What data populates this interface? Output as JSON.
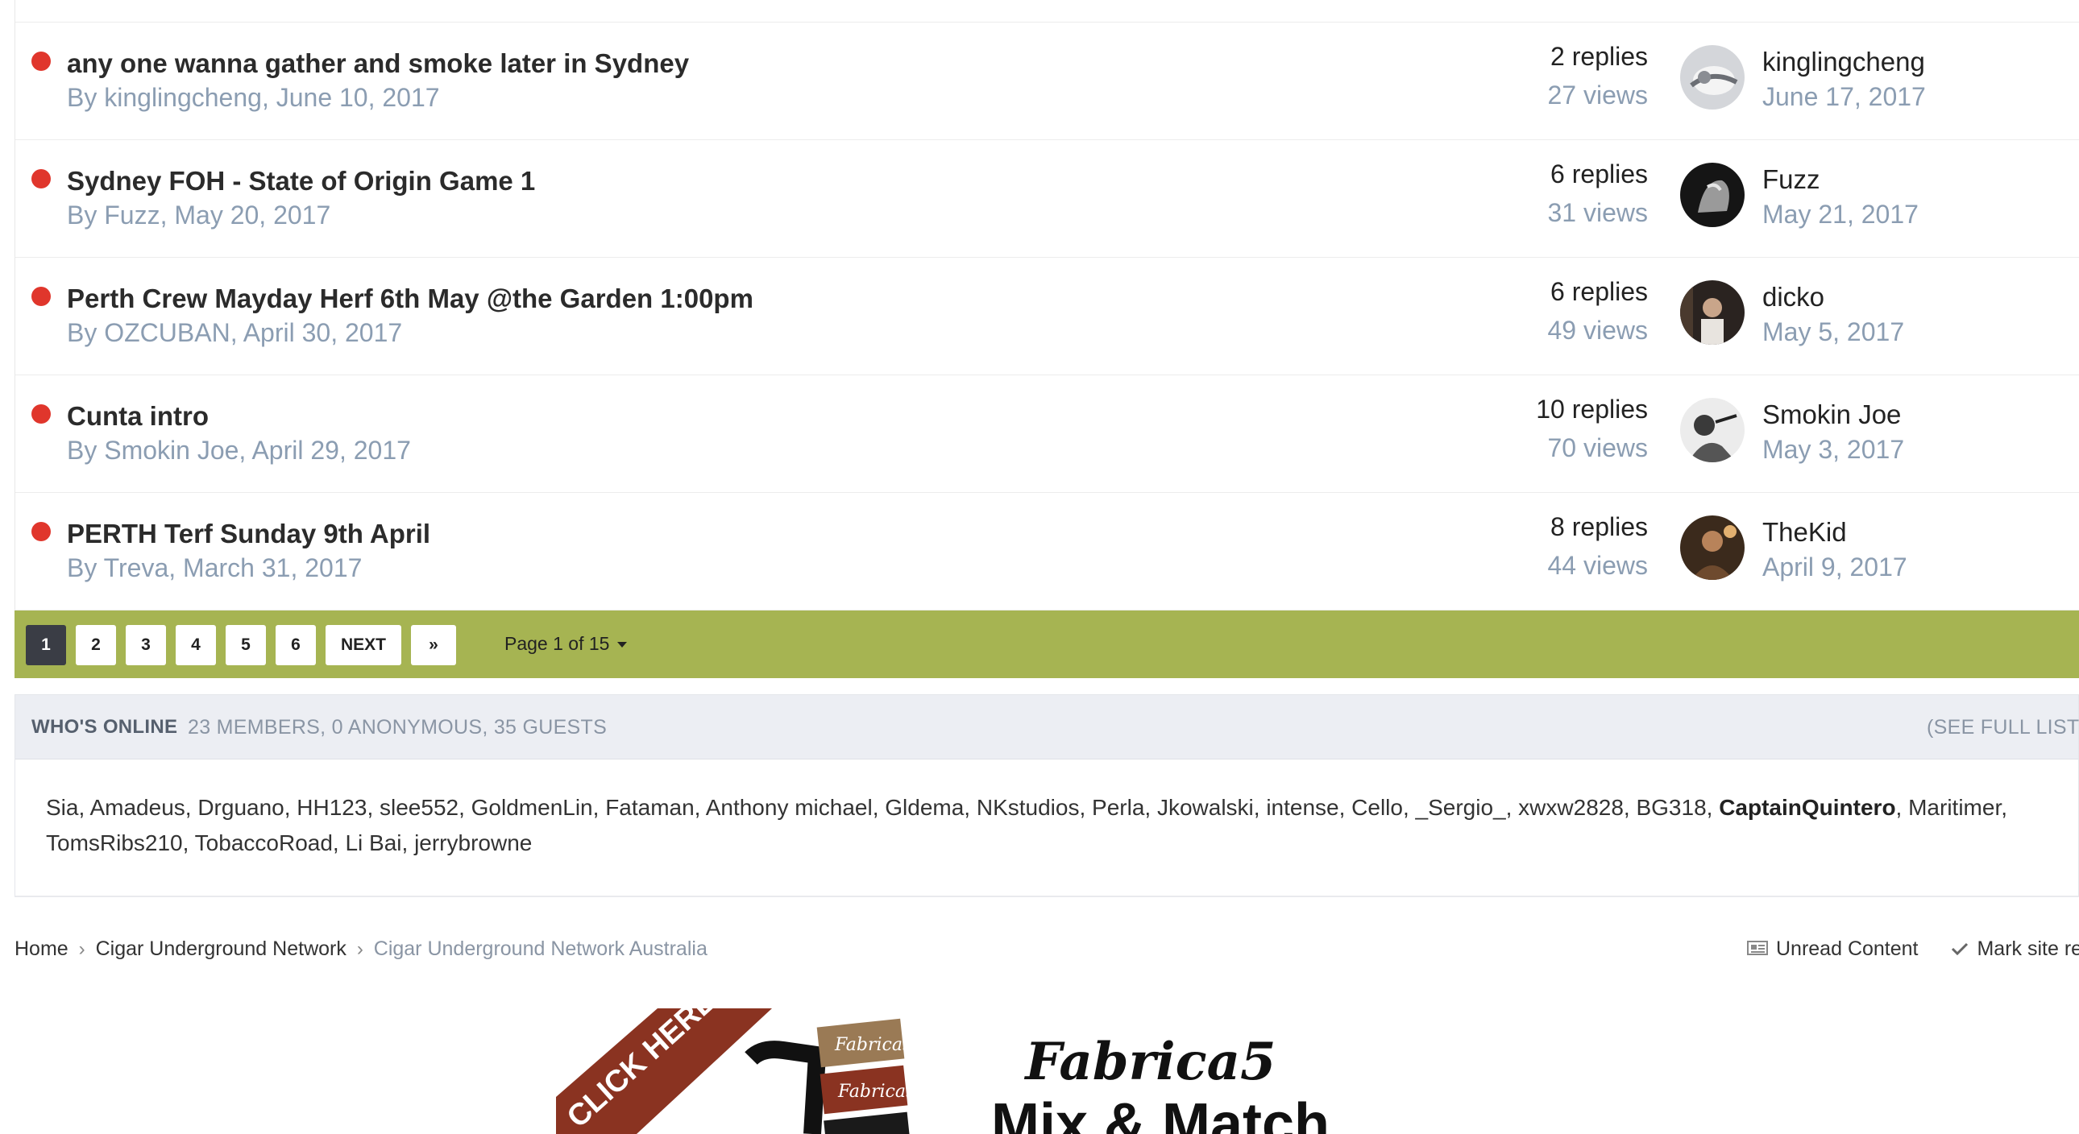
{
  "topics": [
    {
      "title": "any one wanna gather and smoke later in Sydney",
      "meta": "By kinglingcheng, June 10, 2017",
      "replies": "2 replies",
      "views": "27 views",
      "last_poster": "kinglingcheng",
      "last_date": "June 17, 2017"
    },
    {
      "title": "Sydney FOH - State of Origin Game 1",
      "meta": "By Fuzz, May 20, 2017",
      "replies": "6 replies",
      "views": "31 views",
      "last_poster": "Fuzz",
      "last_date": "May 21, 2017"
    },
    {
      "title": "Perth Crew Mayday Herf 6th May @the Garden 1:00pm",
      "meta": "By OZCUBAN, April 30, 2017",
      "replies": "6 replies",
      "views": "49 views",
      "last_poster": "dicko",
      "last_date": "May 5, 2017"
    },
    {
      "title": "Cunta intro",
      "meta": "By Smokin Joe, April 29, 2017",
      "replies": "10 replies",
      "views": "70 views",
      "last_poster": "Smokin Joe",
      "last_date": "May 3, 2017"
    },
    {
      "title": "PERTH Terf Sunday 9th April",
      "meta": "By Treva, March 31, 2017",
      "replies": "8 replies",
      "views": "44 views",
      "last_poster": "TheKid",
      "last_date": "April 9, 2017"
    }
  ],
  "pagination": {
    "pages": [
      "1",
      "2",
      "3",
      "4",
      "5",
      "6"
    ],
    "active_page": "1",
    "next_label": "NEXT",
    "last_label": "»",
    "page_jump": "Page 1 of 15"
  },
  "whos_online": {
    "label": "WHO'S ONLINE",
    "counts": "23 MEMBERS, 0 ANONYMOUS, 35 GUESTS",
    "see_full": "(SEE FULL LIST",
    "members_before": "Sia, Amadeus, Drguano, HH123, slee552, GoldmenLin, Fataman, Anthony michael, Gldema, NKstudios, Perla, Jkowalski, intense, Cello, _Sergio_, xwxw2828, BG318, ",
    "highlight": "CaptainQuintero",
    "members_after": ", Maritimer, TomsRibs210, TobaccoRoad, Li Bai, jerrybrowne"
  },
  "breadcrumb": {
    "items": [
      "Home",
      "Cigar Underground Network",
      "Cigar Underground Network Australia"
    ],
    "separator": "›"
  },
  "actions": {
    "unread": "Unread Content",
    "mark_read": "Mark site re"
  },
  "ad": {
    "banner": "CLICK HERE!",
    "brand": "Fabrica5",
    "headline": "Mix & Match"
  },
  "colors": {
    "unread_dot": "#e0362c",
    "pager_bg": "#a6b452",
    "muted_text": "#8b9db2"
  }
}
